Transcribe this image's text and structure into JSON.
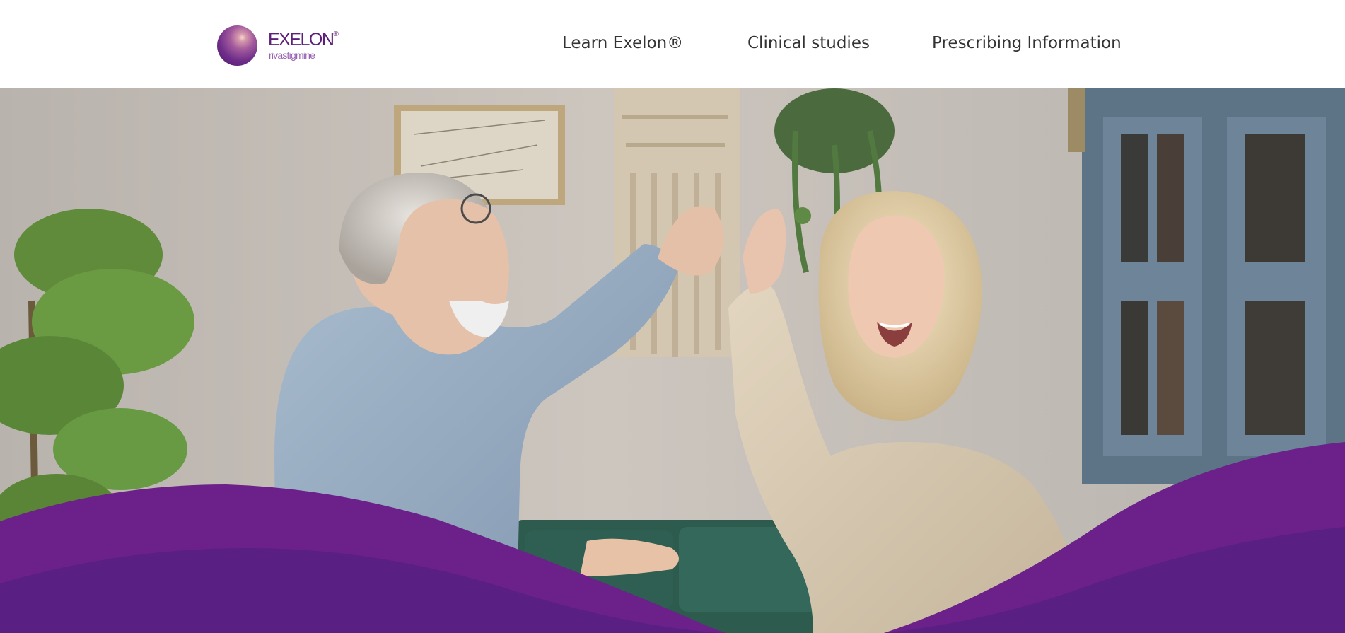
{
  "header": {
    "logo": {
      "brand": "EXELON",
      "registered": "®",
      "generic": "rivastigmine"
    },
    "nav": [
      {
        "label": "Learn Exelon®"
      },
      {
        "label": "Clinical studies"
      },
      {
        "label": "Prescribing Information"
      }
    ]
  },
  "hero": {
    "image": "hero-photo-senior-couple-dancing",
    "wave_colors": {
      "light": "#6b2189",
      "dark": "#5a1f82"
    }
  }
}
